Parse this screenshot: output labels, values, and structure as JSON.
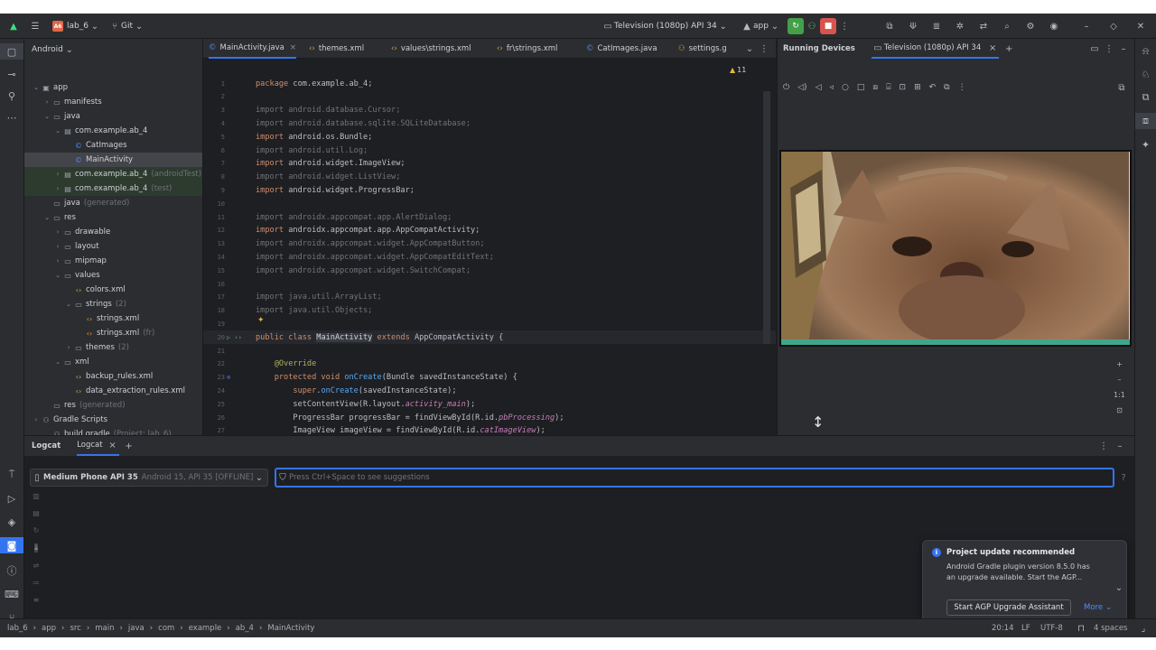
{
  "titlebar": {
    "project": "lab_6",
    "project_badge": "A6",
    "vcs": "Git",
    "device": "Television (1080p) API 34",
    "run_config": "app"
  },
  "project_panel": {
    "title": "Android",
    "tree": [
      {
        "label": "app",
        "dim": "",
        "depth": 0,
        "icon": "module",
        "chev": "down"
      },
      {
        "label": "manifests",
        "dim": "",
        "depth": 1,
        "icon": "folder",
        "chev": "right"
      },
      {
        "label": "java",
        "dim": "",
        "depth": 1,
        "icon": "folder",
        "chev": "down"
      },
      {
        "label": "com.example.ab_4",
        "dim": "",
        "depth": 2,
        "icon": "package",
        "chev": "down"
      },
      {
        "label": "CatImages",
        "dim": "",
        "depth": 3,
        "icon": "class",
        "chev": ""
      },
      {
        "label": "MainActivity",
        "dim": "",
        "depth": 3,
        "icon": "class",
        "chev": ""
      },
      {
        "label": "com.example.ab_4",
        "dim": "(androidTest)",
        "depth": 2,
        "icon": "package",
        "chev": "right"
      },
      {
        "label": "com.example.ab_4",
        "dim": "(test)",
        "depth": 2,
        "icon": "package",
        "chev": "right"
      },
      {
        "label": "java",
        "dim": "(generated)",
        "depth": 1,
        "icon": "folder",
        "chev": ""
      },
      {
        "label": "res",
        "dim": "",
        "depth": 1,
        "icon": "folder",
        "chev": "down"
      },
      {
        "label": "drawable",
        "dim": "",
        "depth": 2,
        "icon": "folder",
        "chev": "right"
      },
      {
        "label": "layout",
        "dim": "",
        "depth": 2,
        "icon": "folder",
        "chev": "right"
      },
      {
        "label": "mipmap",
        "dim": "",
        "depth": 2,
        "icon": "folder",
        "chev": "right"
      },
      {
        "label": "values",
        "dim": "",
        "depth": 2,
        "icon": "folder",
        "chev": "down"
      },
      {
        "label": "colors.xml",
        "dim": "",
        "depth": 3,
        "icon": "xml",
        "chev": ""
      },
      {
        "label": "strings",
        "dim": "(2)",
        "depth": 3,
        "icon": "folder",
        "chev": "down"
      },
      {
        "label": "strings.xml",
        "dim": "",
        "depth": 4,
        "icon": "xml",
        "chev": ""
      },
      {
        "label": "strings.xml",
        "dim": "(fr)",
        "depth": 4,
        "icon": "xml",
        "chev": ""
      },
      {
        "label": "themes",
        "dim": "(2)",
        "depth": 3,
        "icon": "folder",
        "chev": "right"
      },
      {
        "label": "xml",
        "dim": "",
        "depth": 2,
        "icon": "folder",
        "chev": "down"
      },
      {
        "label": "backup_rules.xml",
        "dim": "",
        "depth": 3,
        "icon": "xml",
        "chev": ""
      },
      {
        "label": "data_extraction_rules.xml",
        "dim": "",
        "depth": 3,
        "icon": "xml",
        "chev": ""
      },
      {
        "label": "res",
        "dim": "(generated)",
        "depth": 1,
        "icon": "folder",
        "chev": ""
      },
      {
        "label": "Gradle Scripts",
        "dim": "",
        "depth": 0,
        "icon": "gradle",
        "chev": "right"
      },
      {
        "label": "build.gradle",
        "dim": "(Project: lab_6)",
        "depth": 1,
        "icon": "gradle",
        "chev": ""
      }
    ]
  },
  "editor": {
    "tabs": [
      "MainActivity.java",
      "themes.xml",
      "values\\strings.xml",
      "fr\\strings.xml",
      "CatImages.java",
      "settings.g"
    ],
    "warnings": "11",
    "lines": [
      {
        "n": "1",
        "parts": [
          [
            "kw",
            "package "
          ],
          [
            "id",
            "com.example.ab_4;"
          ]
        ]
      },
      {
        "n": "2",
        "parts": []
      },
      {
        "n": "3",
        "parts": [
          [
            "dimc",
            "import android.database.Cursor;"
          ]
        ]
      },
      {
        "n": "4",
        "parts": [
          [
            "dimc",
            "import android.database.sqlite.SQLiteDatabase;"
          ]
        ]
      },
      {
        "n": "5",
        "parts": [
          [
            "kw",
            "import "
          ],
          [
            "id",
            "android.os.Bundle;"
          ]
        ]
      },
      {
        "n": "6",
        "parts": [
          [
            "dimc",
            "import android.util.Log;"
          ]
        ]
      },
      {
        "n": "7",
        "parts": [
          [
            "kw",
            "import "
          ],
          [
            "id",
            "android.widget.ImageView;"
          ]
        ]
      },
      {
        "n": "8",
        "parts": [
          [
            "dimc",
            "import android.widget.ListView;"
          ]
        ]
      },
      {
        "n": "9",
        "parts": [
          [
            "kw",
            "import "
          ],
          [
            "id",
            "android.widget.ProgressBar;"
          ]
        ]
      },
      {
        "n": "10",
        "parts": []
      },
      {
        "n": "11",
        "parts": [
          [
            "dimc",
            "import androidx.appcompat.app.AlertDialog;"
          ]
        ]
      },
      {
        "n": "12",
        "parts": [
          [
            "kw",
            "import "
          ],
          [
            "id",
            "androidx.appcompat.app.AppCompatActivity;"
          ]
        ]
      },
      {
        "n": "13",
        "parts": [
          [
            "dimc",
            "import androidx.appcompat.widget.AppCompatButton;"
          ]
        ]
      },
      {
        "n": "14",
        "parts": [
          [
            "dimc",
            "import androidx.appcompat.widget.AppCompatEditText;"
          ]
        ]
      },
      {
        "n": "15",
        "parts": [
          [
            "dimc",
            "import androidx.appcompat.widget.SwitchCompat;"
          ]
        ]
      },
      {
        "n": "16",
        "parts": []
      },
      {
        "n": "17",
        "parts": [
          [
            "dimc",
            "import java.util.ArrayList;"
          ]
        ]
      },
      {
        "n": "18",
        "parts": [
          [
            "dimc",
            "import java.util.Objects;"
          ]
        ]
      },
      {
        "n": "19",
        "parts": []
      },
      {
        "n": "20",
        "parts": [
          [
            "kw",
            "public class "
          ],
          [
            "hl",
            "MainActivity"
          ],
          [
            "kw",
            " extends "
          ],
          [
            "id",
            "AppCompatActivity {"
          ]
        ]
      },
      {
        "n": "21",
        "parts": []
      },
      {
        "n": "22",
        "parts": [
          [
            "ann",
            "    @Override"
          ]
        ]
      },
      {
        "n": "23",
        "parts": [
          [
            "kw",
            "    protected void "
          ],
          [
            "fn",
            "onCreate"
          ],
          [
            "id",
            "(Bundle savedInstanceState) {"
          ]
        ]
      },
      {
        "n": "24",
        "parts": [
          [
            "kw",
            "        super"
          ],
          [
            "id",
            "."
          ],
          [
            "fn",
            "onCreate"
          ],
          [
            "id",
            "(savedInstanceState);"
          ]
        ]
      },
      {
        "n": "25",
        "parts": [
          [
            "id",
            "        setContentView(R.layout."
          ],
          [
            "it",
            "activity_main"
          ],
          [
            "id",
            ");"
          ]
        ]
      },
      {
        "n": "26",
        "parts": [
          [
            "id",
            "        ProgressBar progressBar = findViewById(R.id."
          ],
          [
            "it",
            "pbProcessing"
          ],
          [
            "id",
            ");"
          ]
        ]
      },
      {
        "n": "27",
        "parts": [
          [
            "id",
            "        ImageView imageView = findViewById(R.id."
          ],
          [
            "it",
            "catImageView"
          ],
          [
            "id",
            ");"
          ]
        ]
      }
    ]
  },
  "running_devices": {
    "title": "Running Devices",
    "device_tab": "Television (1080p) API 34",
    "zoom_label": "1:1"
  },
  "logcat": {
    "tab_main": "Logcat",
    "tab_active": "Logcat",
    "device": "Medium Phone API 35",
    "device_detail": "Android 15, API 35 [OFFLINE]",
    "filter_placeholder": "Press Ctrl+Space to see suggestions"
  },
  "notification": {
    "title": "Project update recommended",
    "body_line1": "Android Gradle plugin version 8.5.0 has",
    "body_line2": "an upgrade available. Start the AGP...",
    "action": "Start AGP Upgrade Assistant",
    "more": "More"
  },
  "statusbar": {
    "breadcrumbs": [
      "lab_6",
      "app",
      "src",
      "main",
      "java",
      "com",
      "example",
      "ab_4",
      "MainActivity"
    ],
    "position": "20:14",
    "line_sep": "LF",
    "encoding": "UTF-8",
    "indent": "4 spaces"
  }
}
